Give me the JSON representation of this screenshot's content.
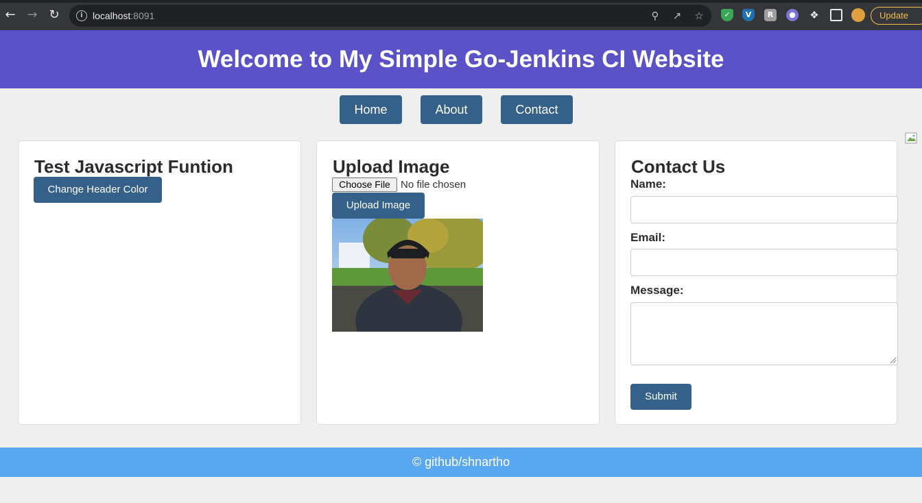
{
  "browser": {
    "url_host": "localhost",
    "url_port": ":8091",
    "update_label": "Update",
    "accent": "#35363a"
  },
  "header": {
    "title": "Welcome to My Simple Go-Jenkins CI Website",
    "bg_color": "#5b52c8"
  },
  "nav": {
    "items": [
      {
        "label": "Home"
      },
      {
        "label": "About"
      },
      {
        "label": "Contact"
      }
    ],
    "button_color": "#356089"
  },
  "js_card": {
    "title": "Test Javascript Funtion",
    "button_label": "Change Header Color"
  },
  "upload_card": {
    "title": "Upload Image",
    "choose_file_label": "Choose File",
    "file_status": "No file chosen",
    "upload_button_label": "Upload Image"
  },
  "contact_card": {
    "title": "Contact Us",
    "name_label": "Name:",
    "email_label": "Email:",
    "message_label": "Message:",
    "name_value": "",
    "email_value": "",
    "message_value": "",
    "submit_label": "Submit"
  },
  "footer": {
    "text": "© github/shnartho",
    "bg_color": "#5aa7f2"
  }
}
